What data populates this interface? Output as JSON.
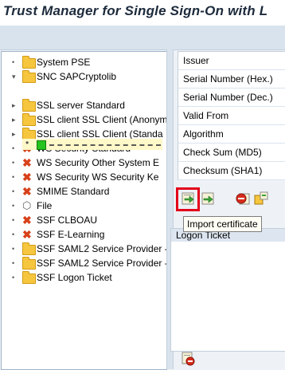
{
  "window": {
    "title": "Trust Manager for Single Sign-On with L"
  },
  "tree": {
    "items": [
      {
        "label": "System PSE",
        "icon": "folder-icon",
        "control": "bullet"
      },
      {
        "label": "SNC SAPCryptolib",
        "icon": "folder-open-icon",
        "control": "expanded"
      },
      {
        "label": "SSL server Standard",
        "icon": "folder-icon",
        "control": "collapsed"
      },
      {
        "label": "SSL client SSL Client (Anonym",
        "icon": "folder-icon",
        "control": "collapsed"
      },
      {
        "label": "SSL client SSL Client (Standa",
        "icon": "folder-icon",
        "control": "collapsed"
      },
      {
        "label": "WS Security Standard",
        "icon": "x-icon",
        "control": "bullet"
      },
      {
        "label": "WS Security Other System E",
        "icon": "x-icon",
        "control": "bullet"
      },
      {
        "label": "WS Security WS Security Ke",
        "icon": "x-icon",
        "control": "bullet"
      },
      {
        "label": "SMIME Standard",
        "icon": "x-icon",
        "control": "bullet"
      },
      {
        "label": "File",
        "icon": "cube-icon",
        "control": "bullet"
      },
      {
        "label": "SSF CLBOAU",
        "icon": "x-icon",
        "control": "bullet"
      },
      {
        "label": "SSF E-Learning",
        "icon": "x-icon",
        "control": "bullet"
      },
      {
        "label": "SSF SAML2 Service Provider -",
        "icon": "folder-icon",
        "control": "bullet"
      },
      {
        "label": "SSF SAML2 Service Provider -",
        "icon": "folder-icon",
        "control": "bullet"
      },
      {
        "label": "SSF Logon Ticket",
        "icon": "folder-ticket-icon",
        "control": "bullet"
      }
    ]
  },
  "details": {
    "fields": [
      "Issuer",
      "Serial Number (Hex.)",
      "Serial Number (Dec.)",
      "Valid From",
      "Algorithm",
      "Check Sum (MD5)",
      "Checksum (SHA1)"
    ]
  },
  "buttons": {
    "import_tooltip": "Import certificate",
    "accent": "#e3001b"
  },
  "logon_ticket": {
    "header": "Logon Ticket"
  }
}
